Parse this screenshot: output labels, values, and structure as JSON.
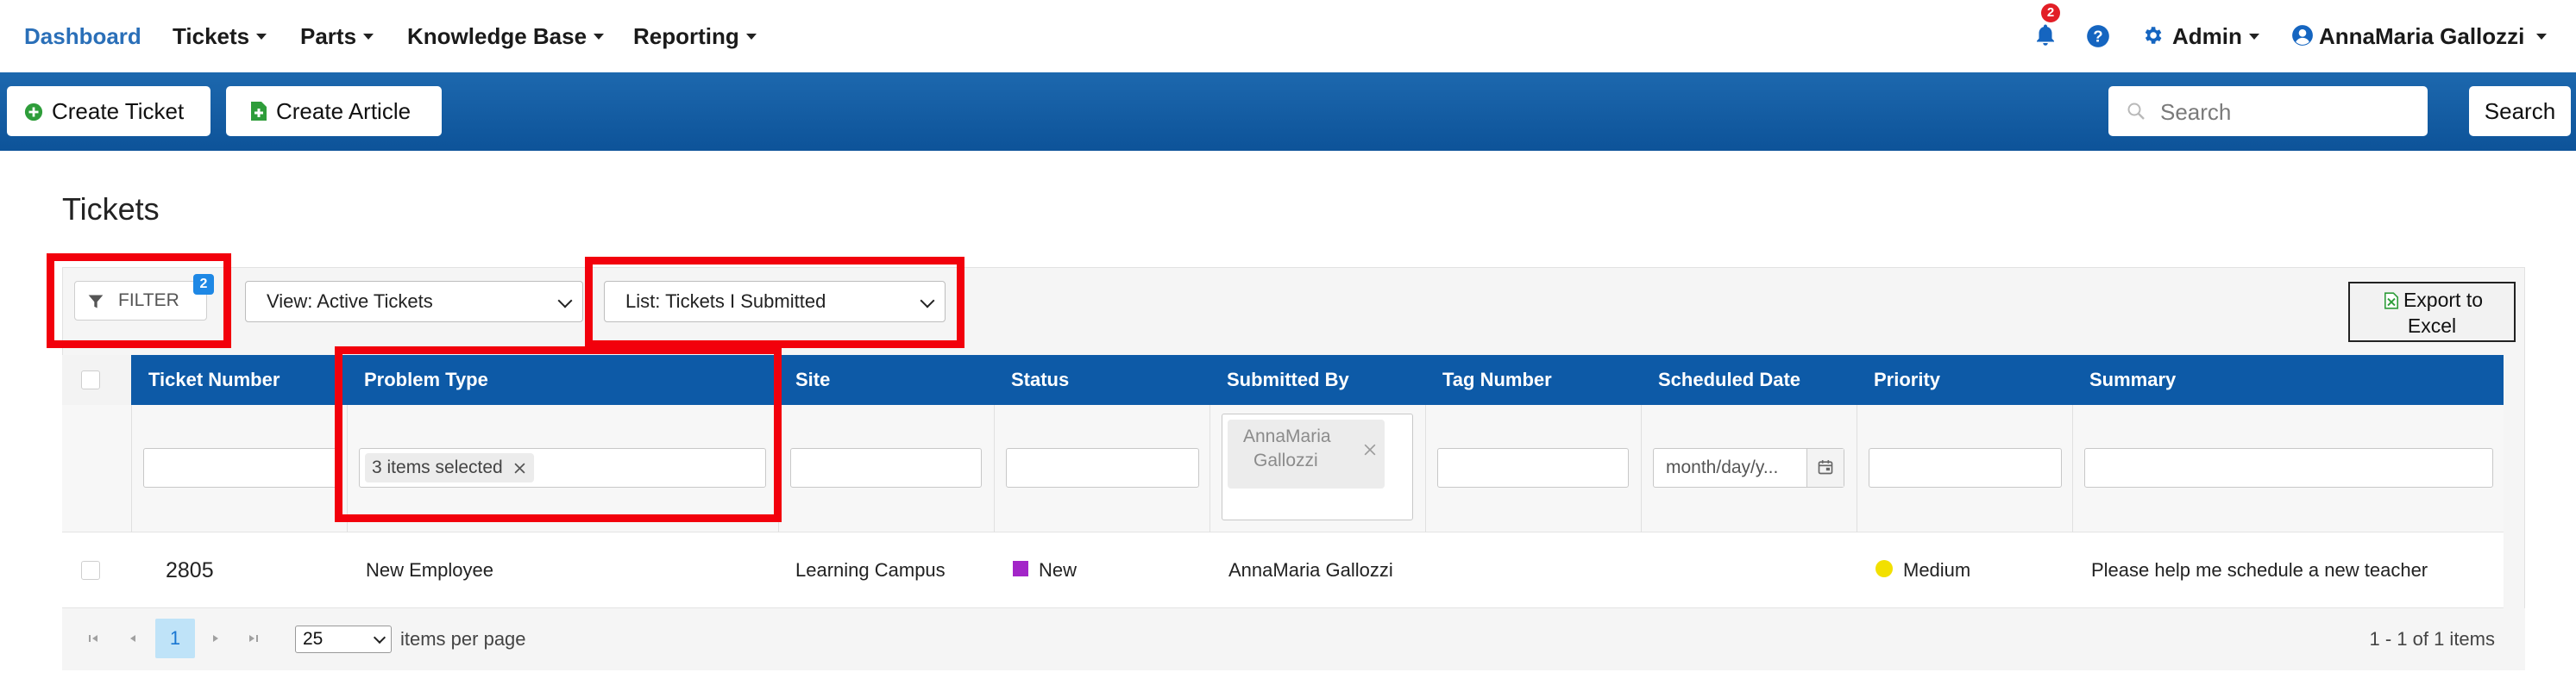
{
  "nav": {
    "dashboard": "Dashboard",
    "tickets": "Tickets",
    "parts": "Parts",
    "knowledge_base": "Knowledge Base",
    "reporting": "Reporting",
    "notifications_count": "2",
    "admin": "Admin",
    "user": "AnnaMaria Gallozzi"
  },
  "toolbar": {
    "create_ticket": "Create Ticket",
    "create_article": "Create Article",
    "search_placeholder": "Search",
    "search_button": "Search"
  },
  "page": {
    "title": "Tickets",
    "filter_label": "FILTER",
    "filter_count": "2",
    "view_select": "View: Active Tickets",
    "list_select": "List: Tickets I Submitted",
    "export_label_1": "Export to",
    "export_label_2": "Excel"
  },
  "table": {
    "columns": [
      "Ticket Number",
      "Problem Type",
      "Site",
      "Status",
      "Submitted By",
      "Tag Number",
      "Scheduled Date",
      "Priority",
      "Summary"
    ],
    "filters": {
      "problem_type": "3 items selected",
      "submitted_by_1": "AnnaMaria",
      "submitted_by_2": "Gallozzi",
      "scheduled_date_placeholder": "month/day/y..."
    },
    "rows": [
      {
        "ticket_number": "2805",
        "problem_type": "New Employee",
        "site": "Learning Campus",
        "status": "New",
        "submitted_by": "AnnaMaria Gallozzi",
        "tag_number": "",
        "scheduled_date": "",
        "priority": "Medium",
        "summary": "Please help me schedule a new teacher"
      }
    ]
  },
  "pager": {
    "current_page": "1",
    "page_size": "25",
    "items_per_page": "items per page",
    "summary": "1 - 1 of 1 items"
  },
  "colors": {
    "brand_blue": "#0d5aa7",
    "highlight_red": "#f2000c",
    "status_new": "#a326c8",
    "priority_medium": "#f2e000"
  }
}
